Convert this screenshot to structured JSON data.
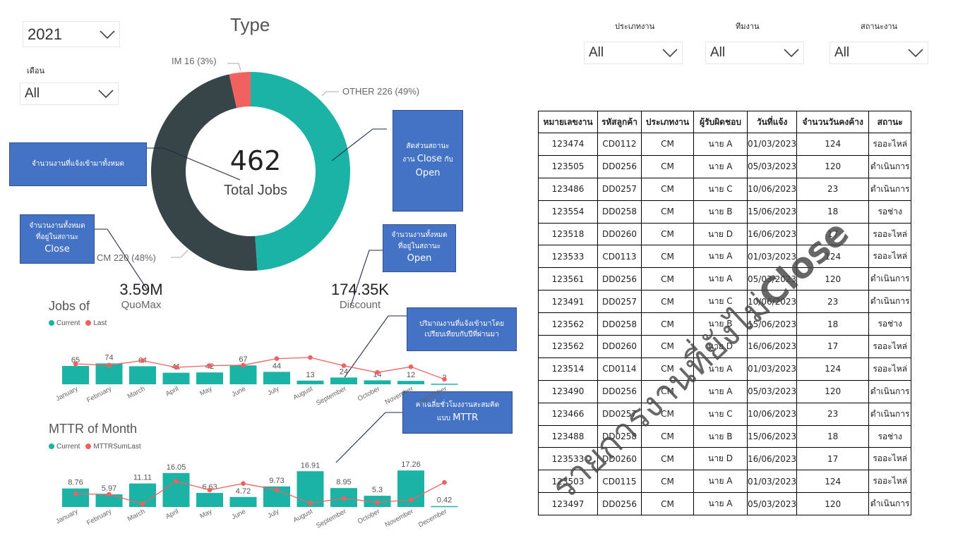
{
  "filters": {
    "year": {
      "value": "2021"
    },
    "month": {
      "label": "เดือน",
      "value": "All"
    },
    "job_type": {
      "label": "ประเภทงาน",
      "value": "All"
    },
    "team": {
      "label": "ทีมงาน",
      "value": "All"
    },
    "status": {
      "label": "สถานะงาน",
      "value": "All"
    }
  },
  "donut": {
    "title": "Type",
    "center_value": "462",
    "center_label": "Total Jobs",
    "labels": {
      "im": "IM 16 (3%)",
      "other": "OTHER 226 (49%)",
      "cm": "CM 220 (48%)"
    }
  },
  "callouts": {
    "total_jobs": "จำนวนงานที่แจ้งเข้ามาทั้งหมด",
    "ratio_line1": "สัดส่วนสถานะ",
    "ratio_line2_pre": "งาน",
    "ratio_close": "Close",
    "ratio_line2_post": "กับ",
    "ratio_open": "Open",
    "close_line1": "จำนวนงานทั้งหมด",
    "close_line2": "ที่อยู่ในสถานะ",
    "close_status": "Close",
    "open_line1": "จำนวนงานทั้งหมด",
    "open_line2": "ที่อยู่ในสถานะ",
    "open_status": "Open",
    "compare_line1": "ปริมาณงานที่แจ้งเข้ามาโดย",
    "compare_line2": "เปรียบเทียบกับปีที่ผ่านมา",
    "mttr_line1": "ค่าเฉลี่ยชั่วโมงงานสะสมคิด",
    "mttr_line2_pre": "แบบ",
    "mttr_term": "MTTR"
  },
  "kpis": {
    "quomax": {
      "value": "3.59M",
      "label": "QuoMax"
    },
    "discount": {
      "value": "174.35K",
      "label": "Discount"
    }
  },
  "table": {
    "headers": [
      "หมายเลขงาน",
      "รหัสลูกค้า",
      "ประเภทงาน",
      "ผู้รับผิดชอบ",
      "วันที่แจ้ง",
      "จำนวนวันคงค้าง",
      "สถานะ"
    ],
    "rows": [
      [
        "123474",
        "CD0112",
        "CM",
        "นาย A",
        "01/03/2023",
        "124",
        "รออะไหล่"
      ],
      [
        "123505",
        "DD0256",
        "CM",
        "นาย A",
        "05/03/2023",
        "120",
        "ดำเนินการ"
      ],
      [
        "123486",
        "DD0257",
        "CM",
        "นาย C",
        "10/06/2023",
        "23",
        "ดำเนินการ"
      ],
      [
        "123554",
        "DD0258",
        "CM",
        "นาย B",
        "15/06/2023",
        "18",
        "รอช่าง"
      ],
      [
        "123518",
        "DD0260",
        "CM",
        "นาย D",
        "16/06/2023",
        "17",
        "รออะไหล่"
      ],
      [
        "123533",
        "CD0113",
        "CM",
        "นาย A",
        "01/03/2023",
        "124",
        "รออะไหล่"
      ],
      [
        "123561",
        "DD0256",
        "CM",
        "นาย A",
        "05/03/2023",
        "120",
        "ดำเนินการ"
      ],
      [
        "123491",
        "DD0257",
        "CM",
        "นาย C",
        "10/06/2023",
        "23",
        "ดำเนินการ"
      ],
      [
        "123562",
        "DD0258",
        "CM",
        "นาย B",
        "15/06/2023",
        "18",
        "รอช่าง"
      ],
      [
        "123562",
        "DD0260",
        "CM",
        "นาย D",
        "16/06/2023",
        "17",
        "รออะไหล่"
      ],
      [
        "123514",
        "CD0114",
        "CM",
        "นาย A",
        "01/03/2023",
        "124",
        "รออะไหล่"
      ],
      [
        "123490",
        "DD0256",
        "CM",
        "นาย A",
        "05/03/2023",
        "120",
        "ดำเนินการ"
      ],
      [
        "123466",
        "DD0257",
        "CM",
        "นาย C",
        "10/06/2023",
        "23",
        "ดำเนินการ"
      ],
      [
        "123488",
        "DD0258",
        "CM",
        "นาย B",
        "15/06/2023",
        "18",
        "รอช่าง"
      ],
      [
        "123533",
        "DD0260",
        "CM",
        "นาย D",
        "16/06/2023",
        "17",
        "รออะไหล่"
      ],
      [
        "123503",
        "CD0115",
        "CM",
        "นาย A",
        "01/03/2023",
        "124",
        "รออะไหล่"
      ],
      [
        "123497",
        "DD0256",
        "CM",
        "นาย A",
        "05/03/2023",
        "120",
        "ดำเนินการ"
      ]
    ]
  },
  "watermark": {
    "text": "รายการงานที่ยังไม่",
    "emphasis": "Close"
  },
  "colors": {
    "teal": "#1ab3a6",
    "red": "#f0615f",
    "dark": "#374549",
    "callout": "#4472c4"
  },
  "chart_data": [
    {
      "type": "pie",
      "title": "Type",
      "categories": [
        "OTHER",
        "CM",
        "IM"
      ],
      "values": [
        226,
        220,
        16
      ],
      "percent": [
        49,
        48,
        3
      ],
      "colors": [
        "#1ab3a6",
        "#374549",
        "#f0615f"
      ]
    },
    {
      "type": "bar",
      "title": "Jobs of",
      "legend": [
        "Current",
        "Last"
      ],
      "categories": [
        "January",
        "February",
        "March",
        "April",
        "May",
        "June",
        "July",
        "August",
        "September",
        "October",
        "November",
        "December"
      ],
      "series": [
        {
          "name": "Current",
          "type": "bar",
          "values": [
            65,
            74,
            64,
            41,
            42,
            67,
            44,
            13,
            24,
            14,
            12,
            2
          ]
        },
        {
          "name": "Last",
          "type": "line",
          "values": [
            72,
            68,
            84,
            60,
            66,
            68,
            91,
            95,
            66,
            42,
            62,
            18
          ]
        }
      ],
      "ylim": [
        0,
        130
      ]
    },
    {
      "type": "bar",
      "title": "MTTR of Month",
      "legend": [
        "Current",
        "MTTRSumLast"
      ],
      "categories": [
        "January",
        "February",
        "March",
        "April",
        "May",
        "June",
        "July",
        "August",
        "September",
        "October",
        "November",
        "December"
      ],
      "series": [
        {
          "name": "Current",
          "type": "bar",
          "values": [
            8.76,
            5.97,
            11.11,
            16.05,
            6.63,
            4.72,
            9.73,
            16.91,
            8.95,
            5.3,
            17.26,
            0.42
          ]
        },
        {
          "name": "MTTRSumLast",
          "type": "line",
          "values": [
            6.2,
            6.0,
            1.5,
            12.2,
            8.0,
            11.1,
            8.1,
            1.8,
            4.1,
            2.2,
            3.3,
            11.6
          ]
        }
      ],
      "ylim": [
        0,
        24
      ]
    }
  ]
}
